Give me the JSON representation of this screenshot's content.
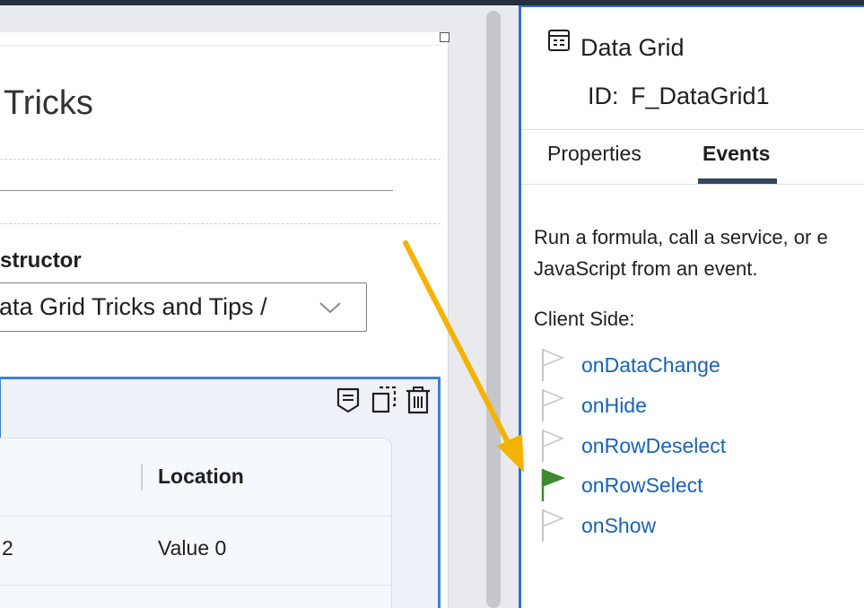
{
  "form": {
    "title": "Tricks",
    "field_label": "structor",
    "select_value": "ata Grid Tricks and Tips /",
    "grid": {
      "column_header": "Location",
      "row1_cell_a": "2",
      "row1_cell_b": "Value 0"
    }
  },
  "panel": {
    "title": "Data Grid",
    "id_label": "ID:",
    "id_value": "F_DataGrid1",
    "tabs": [
      {
        "label": "Properties",
        "active": false
      },
      {
        "label": "Events",
        "active": true
      }
    ],
    "description_line1": "Run a formula, call a service, or e",
    "description_line2": "JavaScript from an event.",
    "client_side_label": "Client Side:",
    "events": [
      {
        "label": "onDataChange",
        "active": false
      },
      {
        "label": "onHide",
        "active": false
      },
      {
        "label": "onRowDeselect",
        "active": false
      },
      {
        "label": "onRowSelect",
        "active": true
      },
      {
        "label": "onShow",
        "active": false
      }
    ]
  },
  "colors": {
    "selection_blue": "#3b82d6",
    "link_blue": "#1a62b5",
    "annotation_arrow": "#f5b301",
    "active_flag": "#3f8a2f"
  }
}
